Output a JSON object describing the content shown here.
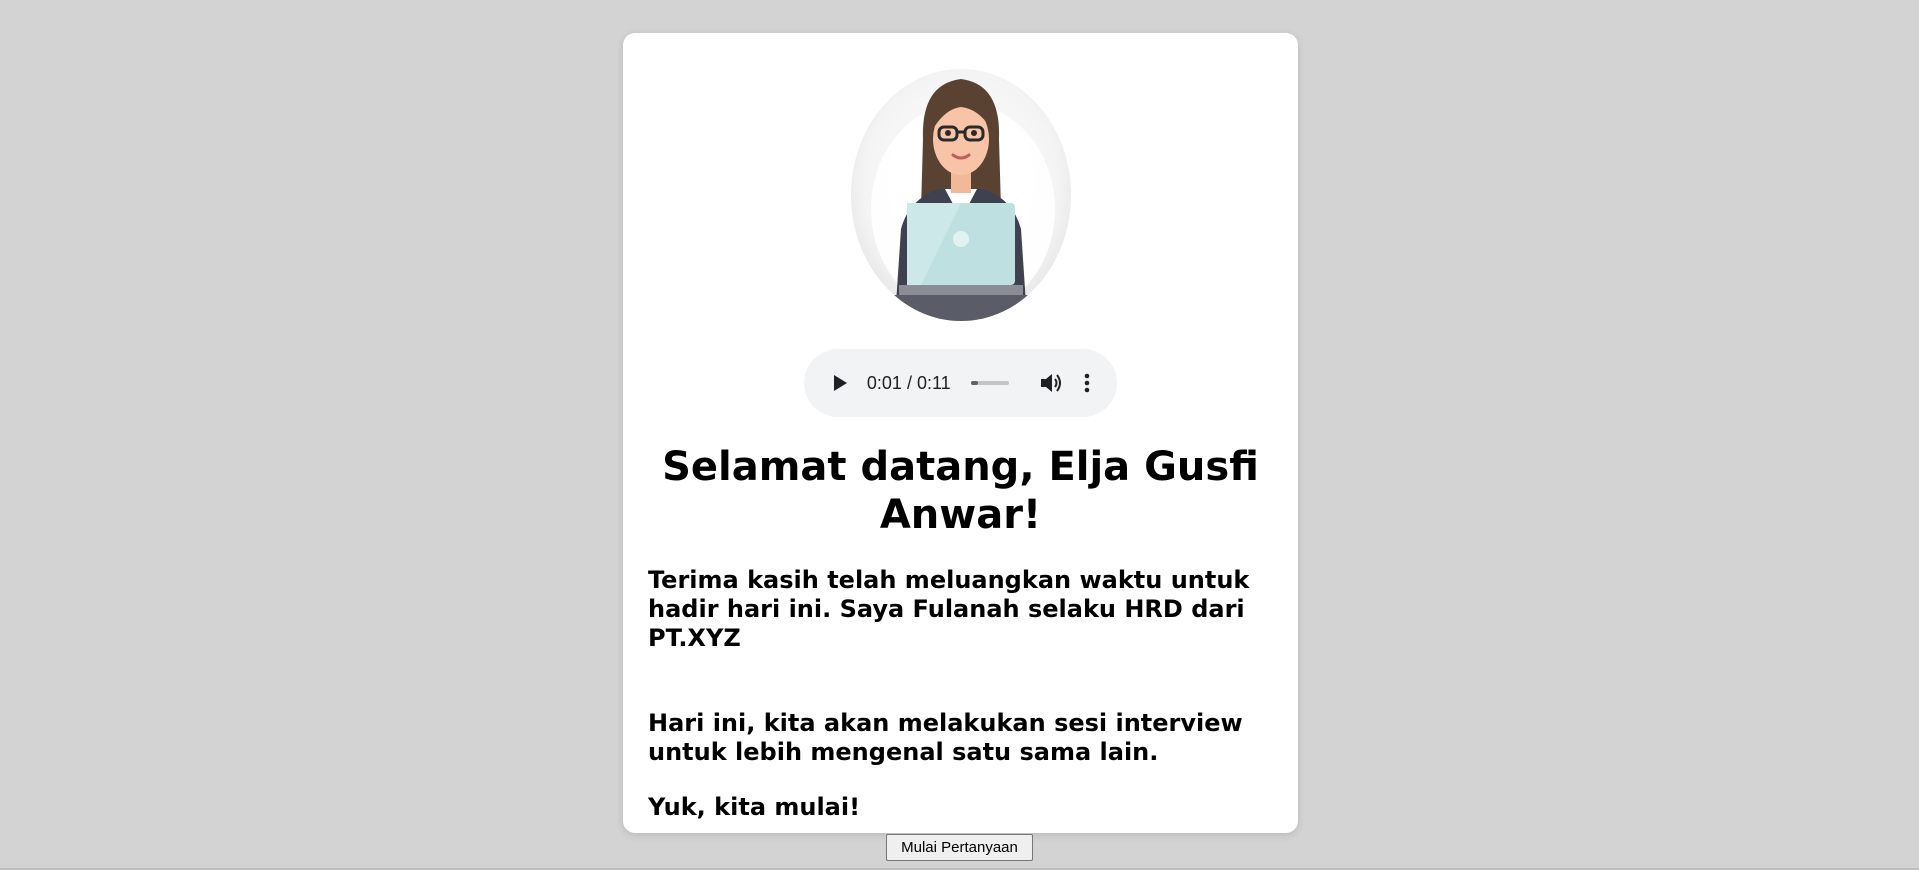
{
  "audio": {
    "time_display": "0:01 / 0:11",
    "progress": 0.09
  },
  "greeting": {
    "title": "Selamat datang, Elja Gusfi Anwar!",
    "paragraph_1": "Terima kasih telah meluangkan waktu untuk hadir hari ini. Saya Fulanah selaku HRD dari PT.XYZ",
    "paragraph_2": "Hari ini, kita akan melakukan sesi interview untuk lebih mengenal satu sama lain.",
    "paragraph_3": "Yuk, kita mulai!"
  },
  "actions": {
    "start_button_label": "Mulai Pertanyaan"
  },
  "icons": {
    "play": "play-icon",
    "volume": "volume-icon",
    "more": "more-vertical-icon",
    "avatar": "hr-woman-laptop-illustration"
  },
  "colors": {
    "page_background": "#d3d3d3",
    "card_background": "#ffffff",
    "player_background": "#f1f3f4",
    "laptop": "#bfe0e0"
  }
}
